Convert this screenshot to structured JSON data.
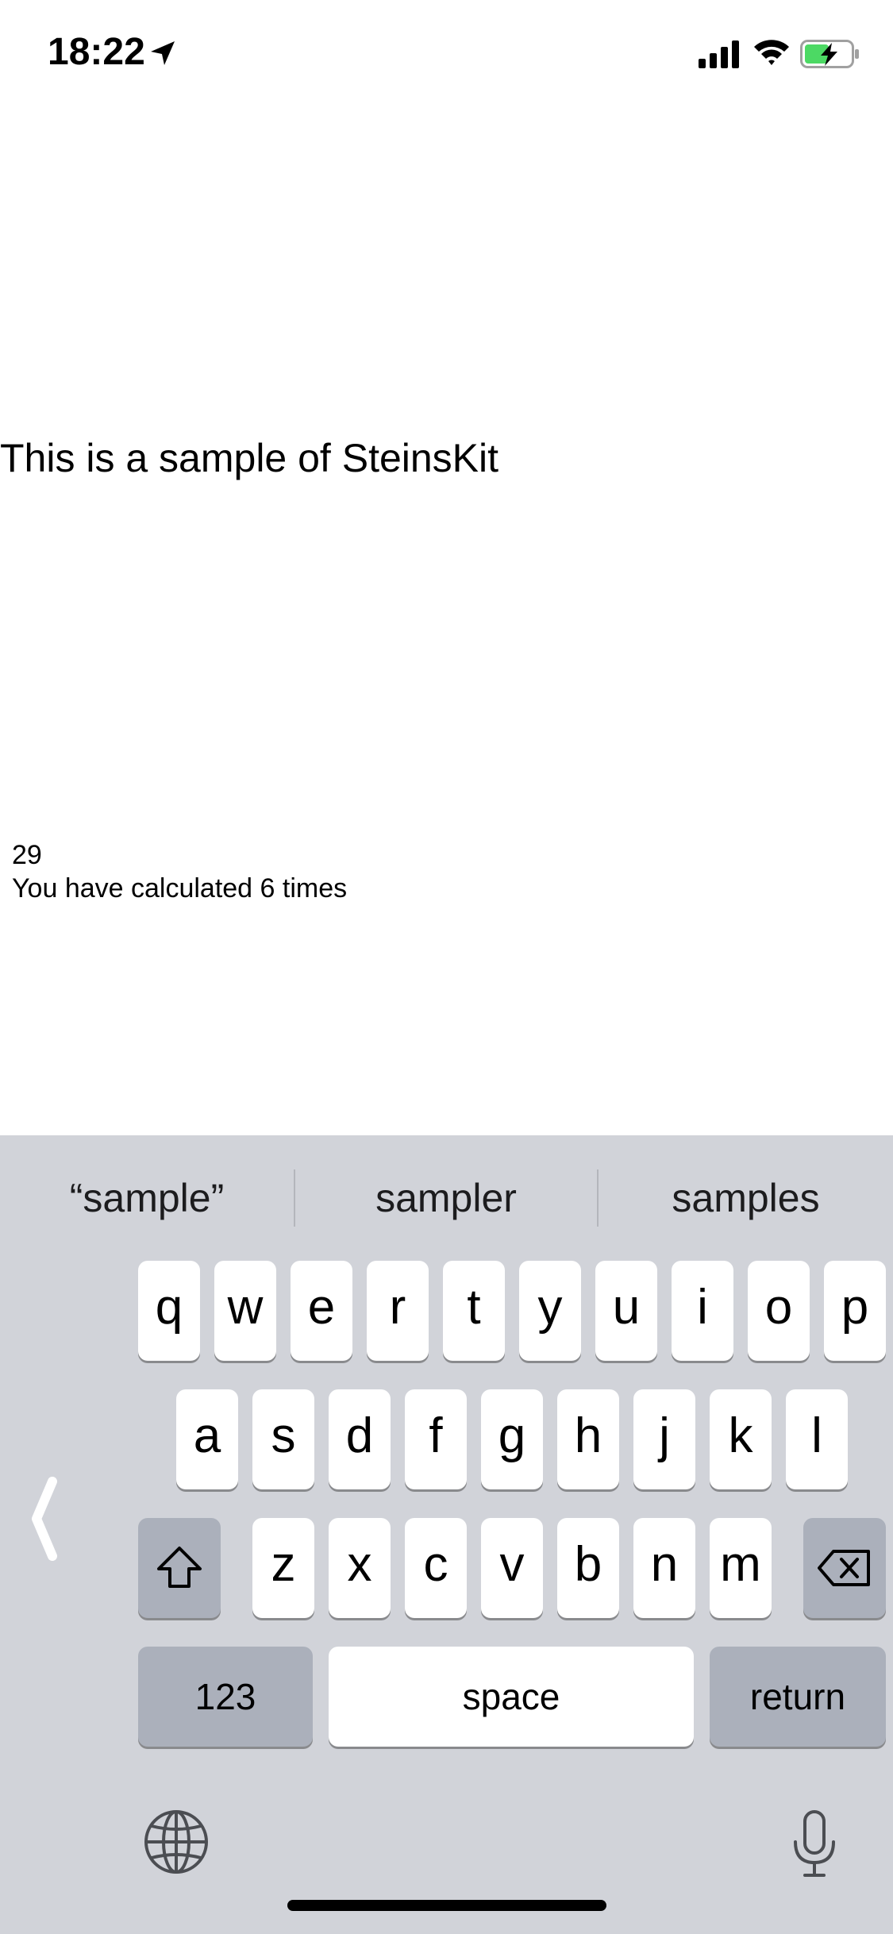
{
  "status_bar": {
    "time": "18:22",
    "icons": [
      "location-arrow-icon",
      "cellular-signal-icon",
      "wifi-icon",
      "battery-charging-icon"
    ]
  },
  "content": {
    "heading": "This is a sample of SteinsKit",
    "result": "29",
    "count_text": "You have calculated 6 times"
  },
  "keyboard": {
    "suggestions": [
      "“sample”",
      "sampler",
      "samples"
    ],
    "row1": [
      "q",
      "w",
      "e",
      "r",
      "t",
      "y",
      "u",
      "i",
      "o",
      "p"
    ],
    "row2": [
      "a",
      "s",
      "d",
      "f",
      "g",
      "h",
      "j",
      "k",
      "l"
    ],
    "row3": [
      "z",
      "x",
      "c",
      "v",
      "b",
      "n",
      "m"
    ],
    "numbers_label": "123",
    "space_label": "space",
    "return_label": "return",
    "icons": [
      "shift-icon",
      "delete-icon",
      "globe-icon",
      "microphone-icon",
      "chevron-left-icon"
    ],
    "colors": {
      "background": "#d1d3d9",
      "key": "#ffffff",
      "special_key": "#abb0bb"
    }
  }
}
